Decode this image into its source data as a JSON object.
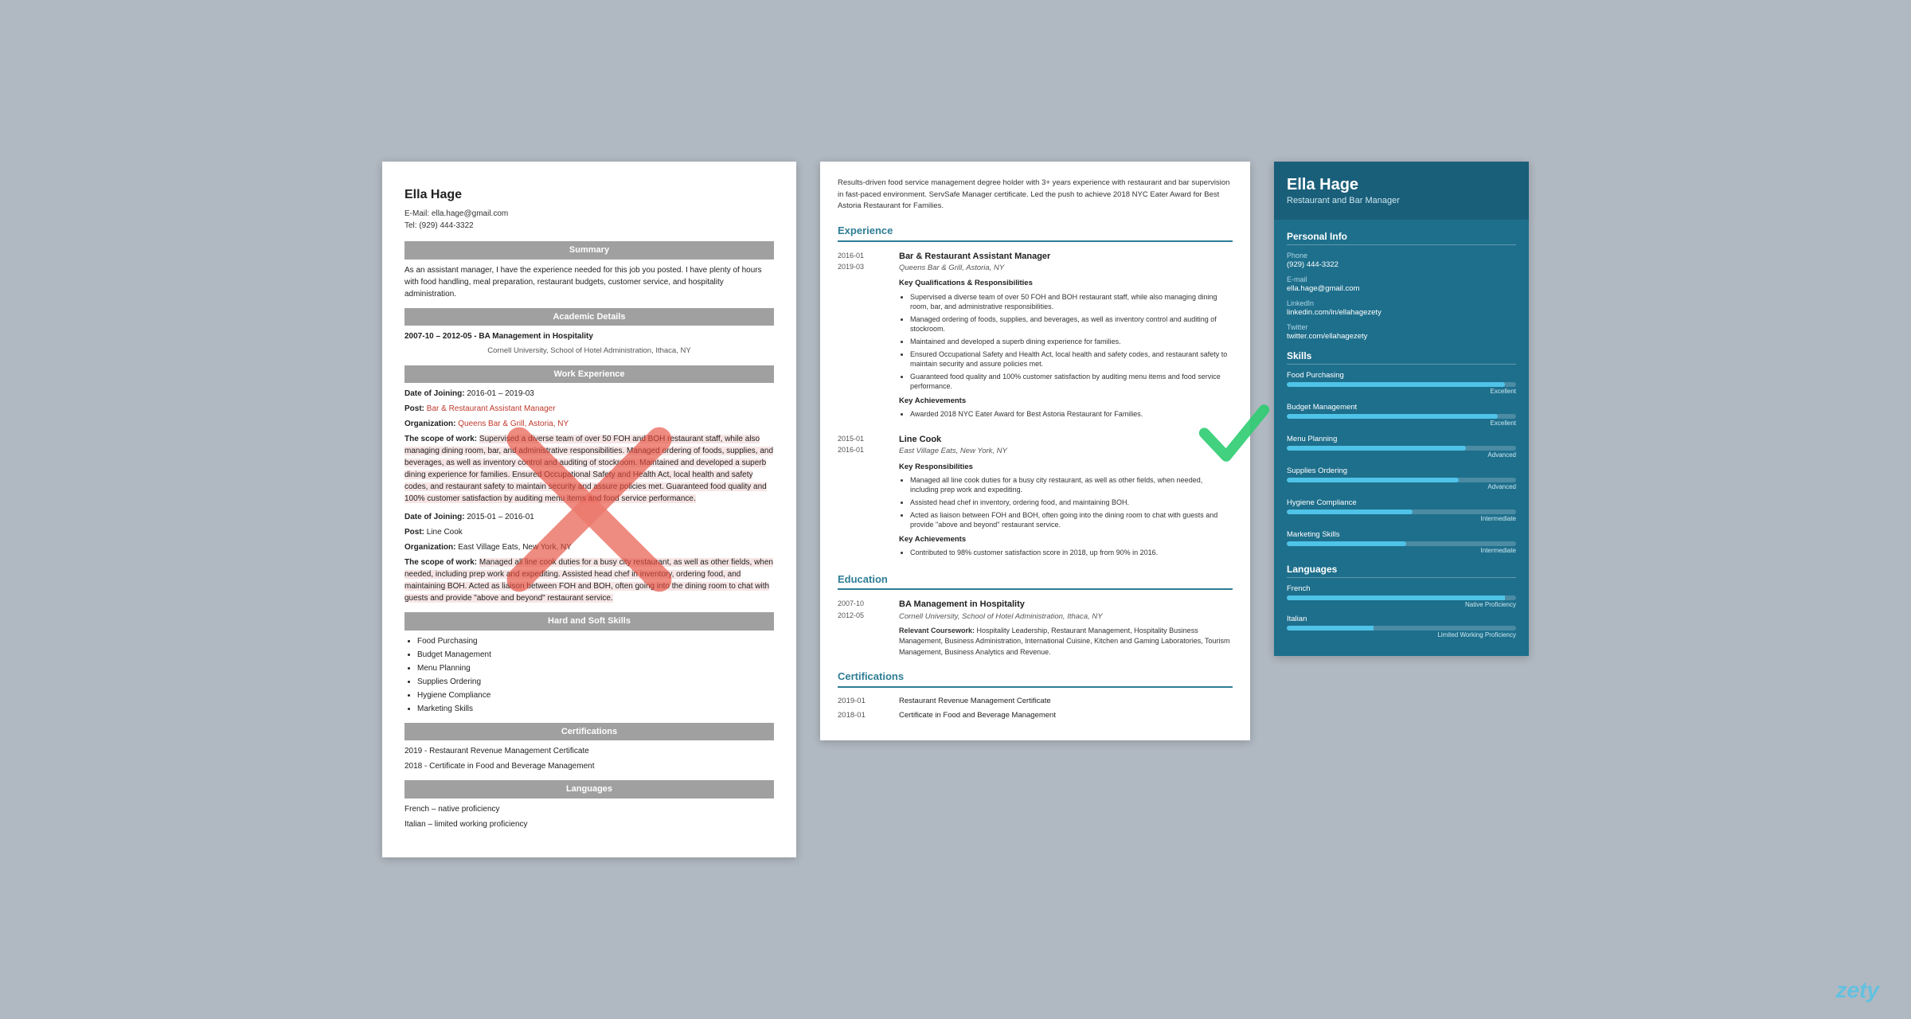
{
  "left_resume": {
    "name": "Ella Hage",
    "email_label": "E-Mail:",
    "email": "ella.hage@gmail.com",
    "tel_label": "Tel:",
    "tel": "(929) 444-3322",
    "sections": {
      "summary": {
        "header": "Summary",
        "text": "As an assistant manager, I have the experience needed for this job you posted. I have plenty of hours with food handling, meal preparation, restaurant budgets, customer service, and hospitality administration."
      },
      "academic": {
        "header": "Academic Details",
        "entry": "2007-10 – 2012-05  -  BA Management in Hospitality",
        "school": "Cornell University, School of Hotel Administration, Ithaca, NY"
      },
      "work": {
        "header": "Work Experience",
        "job1": {
          "date": "Date of Joining: 2016-01 – 2019-03",
          "post": "Post: Bar & Restaurant Assistant Manager",
          "org": "Organization: Queens Bar & Grill, Astoria, NY",
          "scope_label": "The scope of work:",
          "scope": "Supervised a diverse team of over 50 FOH and BOH restaurant staff, while also managing dining room, bar, and administrative responsibilities. Managed ordering of foods, supplies, and beverages, as well as inventory control and auditing of stockroom. Maintained and developed a superb dining experience for families. Ensured Occupational Safety and Health Act, local health and safety codes, and restaurant safety to maintain security and assure policies met. Guaranteed food quality and 100% customer satisfaction by auditing menu items and food service performance."
        },
        "job2": {
          "date": "Date of Joining: 2015-01 – 2016-01",
          "post": "Post: Line Cook",
          "org": "Organization: East Village Eats, New York, NY",
          "scope_label": "The scope of work:",
          "scope": "Managed all line cook duties for a busy city restaurant, as well as other fields, when needed, including prep work and expediting. Assisted head chef in inventory, ordering food, and maintaining BOH. Acted as liaison between FOH and BOH, often going into the dining room to chat with guests and provide \"above and beyond\" restaurant service."
        }
      },
      "skills": {
        "header": "Hard and Soft Skills",
        "list": [
          "Food Purchasing",
          "Budget Management",
          "Menu Planning",
          "Supplies Ordering",
          "Hygiene Compliance",
          "Marketing Skills"
        ]
      },
      "certifications": {
        "header": "Certifications",
        "items": [
          "2019 - Restaurant Revenue Management Certificate",
          "2018 - Certificate in Food and Beverage Management"
        ]
      },
      "languages": {
        "header": "Languages",
        "items": [
          "French – native proficiency",
          "Italian – limited working proficiency"
        ]
      }
    }
  },
  "middle_resume": {
    "summary": "Results-driven food service management degree holder with 3+ years experience with restaurant and bar supervision in fast-paced environment. ServSafe Manager certificate. Led the push to achieve 2018 NYC Eater Award for Best Astoria Restaurant for Families.",
    "sections": {
      "experience": {
        "title": "Experience",
        "jobs": [
          {
            "date_start": "2016-01",
            "date_end": "2019-03",
            "title": "Bar & Restaurant Assistant Manager",
            "org": "Queens Bar & Grill, Astoria, NY",
            "qualifications_header": "Key Qualifications & Responsibilities",
            "responsibilities": [
              "Supervised a diverse team of over 50 FOH and BOH restaurant staff, while also managing dining room, bar, and administrative responsibilities.",
              "Managed ordering of foods, supplies, and beverages, as well as inventory control and auditing of stockroom.",
              "Maintained and developed a superb dining experience for families.",
              "Ensured Occupational Safety and Health Act, local health and safety codes, and restaurant safety to maintain security and assure policies met.",
              "Guaranteed food quality and 100% customer satisfaction by auditing menu items and food service performance."
            ],
            "achievements_header": "Key Achievements",
            "achievements": [
              "Awarded 2018 NYC Eater Award for Best Astoria Restaurant for Families."
            ]
          },
          {
            "date_start": "2015-01",
            "date_end": "2016-01",
            "title": "Line Cook",
            "org": "East Village Eats, New York, NY",
            "responsibilities_header": "Key Responsibilities",
            "responsibilities": [
              "Managed all line cook duties for a busy city restaurant, as well as other fields, when needed, including prep work and expediting.",
              "Assisted head chef in inventory, ordering food, and maintaining BOH.",
              "Acted as liaison between FOH and BOH, often going into the dining room to chat with guests and provide \"above and beyond\" restaurant service."
            ],
            "achievements_header": "Key Achievements",
            "achievements": [
              "Contributed to 98% customer satisfaction score in 2018, up from 90% in 2016."
            ]
          }
        ]
      },
      "education": {
        "title": "Education",
        "date_start": "2007-10",
        "date_end": "2012-05",
        "degree": "BA Management in Hospitality",
        "school": "Cornell University, School of Hotel Administration, Ithaca, NY",
        "coursework_label": "Relevant Coursework:",
        "coursework": "Hospitality Leadership, Restaurant Management, Hospitality Business Management, Business Administration, International Cuisine, Kitchen and Gaming Laboratories, Tourism Management, Business Analytics and Revenue."
      },
      "certifications": {
        "title": "Certifications",
        "items": [
          {
            "date": "2019-01",
            "name": "Restaurant Revenue Management Certificate"
          },
          {
            "date": "2018-01",
            "name": "Certificate in Food and Beverage Management"
          }
        ]
      }
    }
  },
  "right_resume": {
    "name": "Ella Hage",
    "title": "Restaurant and Bar Manager",
    "sections": {
      "personal_info": {
        "title": "Personal Info",
        "phone_label": "Phone",
        "phone": "(929) 444-3322",
        "email_label": "E-mail",
        "email": "ella.hage@gmail.com",
        "linkedin_label": "LinkedIn",
        "linkedin": "linkedin.com/in/ellahagezety",
        "twitter_label": "Twitter",
        "twitter": "twitter.com/ellahagezety"
      },
      "skills": {
        "title": "Skills",
        "items": [
          {
            "name": "Food Purchasing",
            "percent": 95,
            "level": "Excellent"
          },
          {
            "name": "Budget Management",
            "percent": 92,
            "level": "Excellent"
          },
          {
            "name": "Menu Planning",
            "percent": 78,
            "level": "Advanced"
          },
          {
            "name": "Supplies Ordering",
            "percent": 75,
            "level": "Advanced"
          },
          {
            "name": "Hygiene Compliance",
            "percent": 55,
            "level": "Intermediate"
          },
          {
            "name": "Marketing Skills",
            "percent": 52,
            "level": "Intermediate"
          }
        ]
      },
      "languages": {
        "title": "Languages",
        "items": [
          {
            "name": "French",
            "percent": 95,
            "level": "Native Proficiency"
          },
          {
            "name": "Italian",
            "percent": 38,
            "level": "Limited Working Proficiency"
          }
        ]
      }
    }
  },
  "watermark": "zety"
}
